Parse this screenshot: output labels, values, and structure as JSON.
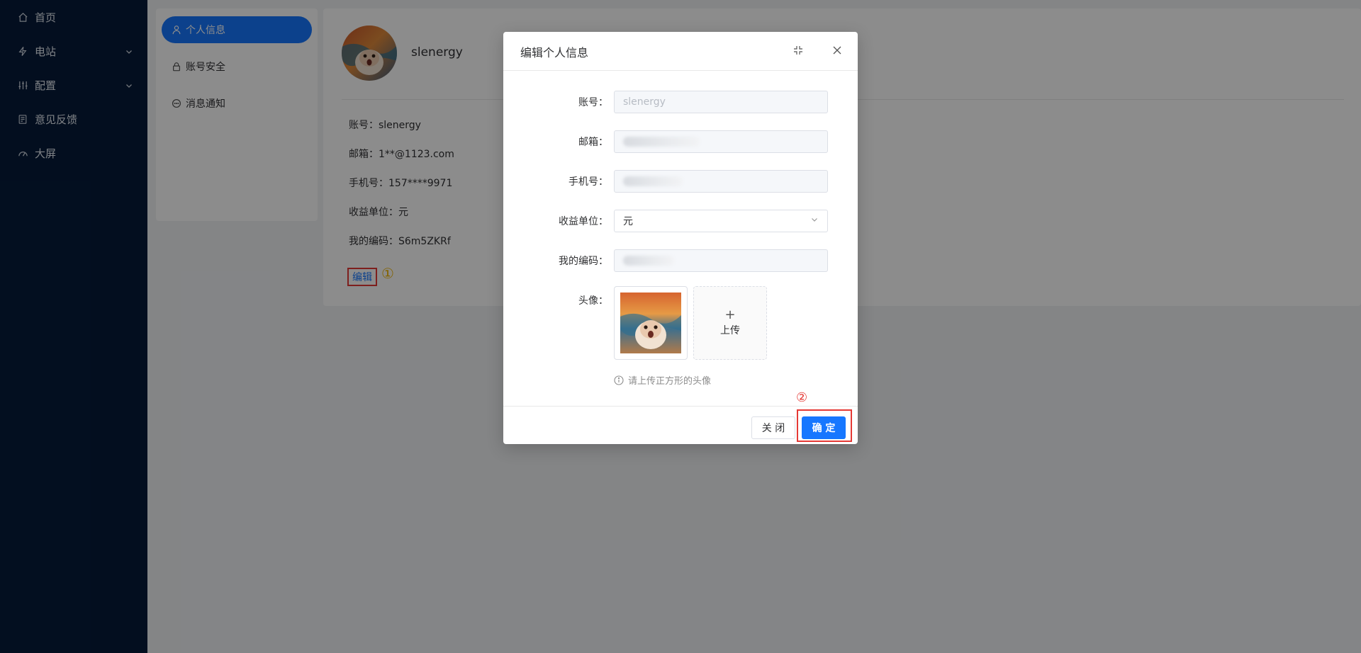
{
  "nav": {
    "items": [
      {
        "label": "首页",
        "icon": "home-icon"
      },
      {
        "label": "电站",
        "icon": "lightning-icon"
      },
      {
        "label": "配置",
        "icon": "sliders-icon"
      },
      {
        "label": "意见反馈",
        "icon": "feedback-icon"
      },
      {
        "label": "大屏",
        "icon": "dashboard-icon"
      }
    ]
  },
  "submenu": {
    "items": [
      {
        "label": "个人信息"
      },
      {
        "label": "账号安全"
      },
      {
        "label": "消息通知"
      }
    ]
  },
  "profile": {
    "username": "slenergy",
    "rows": [
      "账号：slenergy",
      "邮箱：1**@1123.com",
      "手机号：157****9971",
      "收益单位：元",
      "我的编码：S6m5ZKRf"
    ],
    "edit_label": "编辑",
    "marker1": "①"
  },
  "modal": {
    "title": "编辑个人信息",
    "fields": {
      "account_label": "账号：",
      "account_value": "slenergy",
      "email_label": "邮箱：",
      "phone_label": "手机号：",
      "unit_label": "收益单位：",
      "unit_value": "元",
      "code_label": "我的编码：",
      "avatar_label": "头像："
    },
    "upload_label": "上传",
    "upload_plus": "+",
    "hint": "请上传正方形的头像",
    "close_label": "关 闭",
    "ok_label": "确 定",
    "marker2": "②"
  },
  "colors": {
    "primary": "#1677ff",
    "nav_bg": "#061b3a",
    "highlight": "#e53935",
    "marker1": "#f0b400"
  }
}
